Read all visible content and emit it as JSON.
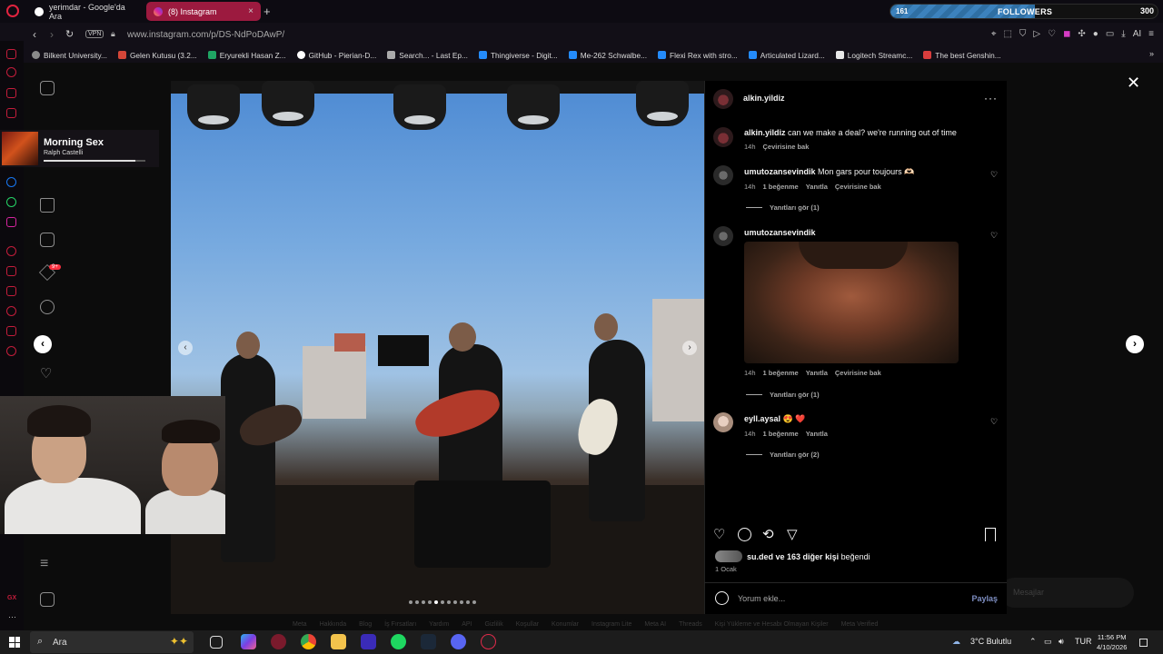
{
  "browser": {
    "tabs": [
      {
        "label": "yerimdar - Google'da Ara",
        "active": false
      },
      {
        "label": "(8) Instagram",
        "active": true
      }
    ],
    "followers": {
      "current": "161",
      "label": "FOLLOWERS",
      "goal": "300",
      "progress": 0.54
    },
    "vpn_label": "VPN",
    "url": "www.instagram.com/p/DS-NdPoDAwP/",
    "ai_label": "AI",
    "bookmarks": [
      {
        "label": "Bilkent University...",
        "color": "#8a8a8a"
      },
      {
        "label": "Gelen Kutusu (3.2...",
        "color": "#d44638"
      },
      {
        "label": "Eryurekli Hasan Z...",
        "color": "#1fa463"
      },
      {
        "label": "GitHub - Pierian-D...",
        "color": "#ffffff"
      },
      {
        "label": "Search... - Last Ep...",
        "color": "#aaaaaa"
      },
      {
        "label": "Thingiverse - Digit...",
        "color": "#248bfb"
      },
      {
        "label": "Me-262 Schwalbe...",
        "color": "#248bfb"
      },
      {
        "label": "Flexi Rex with stro...",
        "color": "#248bfb"
      },
      {
        "label": "Articulated Lizard...",
        "color": "#248bfb"
      },
      {
        "label": "Logitech Streamc...",
        "color": "#e8e8e8"
      },
      {
        "label": "The best Genshin...",
        "color": "#d93d3d"
      }
    ]
  },
  "music": {
    "title": "Morning Sex",
    "artist": "Ralph Castelli",
    "progress": 0.9
  },
  "post": {
    "author": "alkin.yildiz",
    "caption": {
      "user": "alkin.yildiz",
      "text": "can we make a deal? we're running out of time",
      "time": "14h",
      "translate": "Çevirisine bak"
    },
    "comments": [
      {
        "user": "umutozansevindik",
        "text": "Mon gars pour toujours 🫶🏻",
        "time": "14h",
        "likes": "1 beğenme",
        "reply": "Yanıtla",
        "translate": "Çevirisine bak",
        "view_replies": "Yanıtları gör (1)"
      },
      {
        "user": "umutozansevindik",
        "text": "",
        "time": "14h",
        "likes": "1 beğenme",
        "reply": "Yanıtla",
        "translate": "Çevirisine bak",
        "view_replies": "Yanıtları gör (1)"
      },
      {
        "user": "eyll.aysal",
        "text": "😍 ❤️",
        "time": "14h",
        "likes": "1 beğenme",
        "reply": "Yanıtla",
        "view_replies": "Yanıtları gör (2)"
      }
    ],
    "liked_by": {
      "names": "su.ded",
      "rest": "ve 163 diğer kişi",
      "verb": "beğendi"
    },
    "date": "1 Ocak",
    "add_comment_placeholder": "Yorum ekle...",
    "share_label": "Paylaş"
  },
  "instagram": {
    "messages_label": "Mesajlar",
    "notif_badge": "9+",
    "footer_links": [
      "Meta",
      "Hakkında",
      "Blog",
      "İş Fırsatları",
      "Yardım",
      "API",
      "Gizlilik",
      "Koşullar",
      "Konumlar",
      "Instagram Lite",
      "Meta AI",
      "Threads",
      "Kişi Yükleme ve Hesabı Olmayan Kişiler",
      "Meta Verified"
    ]
  },
  "taskbar": {
    "search_placeholder": "Ara",
    "weather": "3°C Bulutlu",
    "lang": "TUR",
    "time": "11:56 PM",
    "date": "4/10/2026"
  }
}
